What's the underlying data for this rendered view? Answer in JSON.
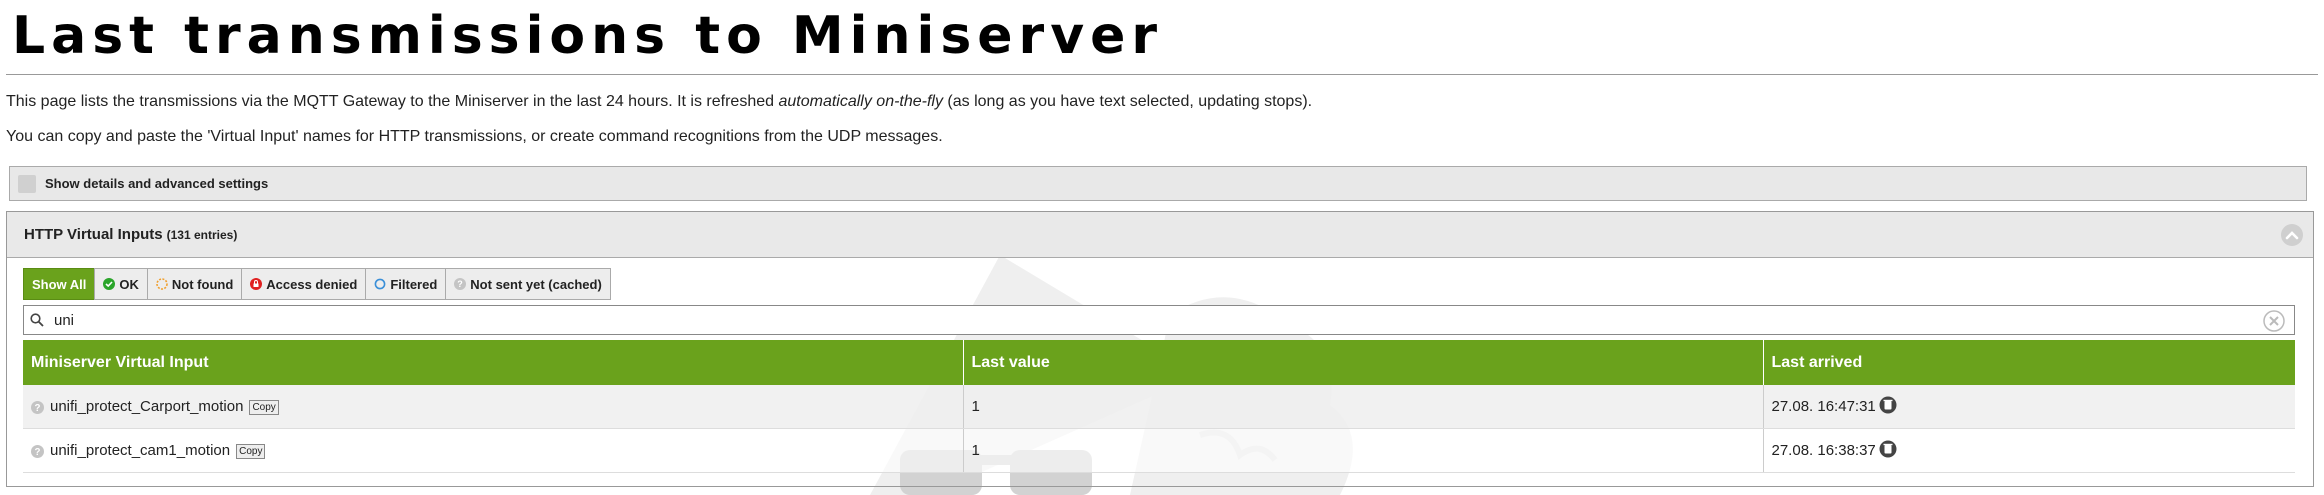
{
  "page": {
    "title": "Last transmissions to Miniserver",
    "intro_line1_a": "This page lists the transmissions via the MQTT Gateway to the Miniserver in the last 24 hours. It is refreshed ",
    "intro_line1_em": "automatically on-the-fly",
    "intro_line1_b": " (as long as you have text selected, updating stops).",
    "intro_line2": "You can copy and paste the 'Virtual Input' names for HTTP transmissions, or create command recognitions from the UDP messages."
  },
  "details": {
    "label": "Show details and advanced settings"
  },
  "panel": {
    "title": "HTTP Virtual Inputs",
    "count": "(131 entries)"
  },
  "filters": [
    {
      "label": "Show All",
      "icon": "",
      "active": true
    },
    {
      "label": "OK",
      "icon": "check-circle-icon",
      "color": "#2aa52a"
    },
    {
      "label": "Not found",
      "icon": "not-found-icon",
      "color": "#f0a030"
    },
    {
      "label": "Access denied",
      "icon": "denied-icon",
      "color": "#e02020"
    },
    {
      "label": "Filtered",
      "icon": "filtered-icon",
      "color": "#3a8fd8"
    },
    {
      "label": "Not sent yet (cached)",
      "icon": "cached-icon",
      "color": "#aaaaaa"
    }
  ],
  "search": {
    "value": "uni",
    "placeholder": ""
  },
  "table": {
    "columns": [
      "Miniserver Virtual Input",
      "Last value",
      "Last arrived"
    ],
    "copy_label": "Copy",
    "rows": [
      {
        "input": "unifi_protect_Carport_motion",
        "value": "1",
        "arrived": "27.08. 16:47:31"
      },
      {
        "input": "unifi_protect_cam1_motion",
        "value": "1",
        "arrived": "27.08. 16:38:37"
      }
    ]
  },
  "colors": {
    "accent_green": "#6aa21c"
  }
}
